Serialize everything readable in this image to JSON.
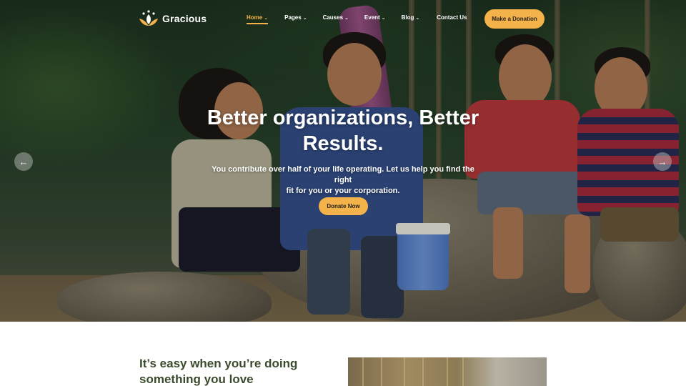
{
  "brand": {
    "name": "Gracious",
    "accent": "#f4b34a"
  },
  "nav": {
    "items": [
      {
        "label": "Home",
        "dropdown": true,
        "active": true
      },
      {
        "label": "Pages",
        "dropdown": true,
        "active": false
      },
      {
        "label": "Causes",
        "dropdown": true,
        "active": false
      },
      {
        "label": "Event",
        "dropdown": true,
        "active": false
      },
      {
        "label": "Blog",
        "dropdown": true,
        "active": false
      },
      {
        "label": "Contact Us",
        "dropdown": false,
        "active": false
      }
    ],
    "cta_label": "Make a Donation"
  },
  "hero": {
    "title_line1": "Better organizations, Better",
    "title_line2": "Results.",
    "subtitle_line1": "You contribute over half of your life operating. Let us help you find the right",
    "subtitle_line2": "fit for you or your corporation.",
    "button_label": "Donate Now",
    "prev_icon": "arrow-left-icon",
    "next_icon": "arrow-right-icon"
  },
  "intro": {
    "title_line1": "It’s easy when you’re doing",
    "title_line2": "something you love"
  }
}
